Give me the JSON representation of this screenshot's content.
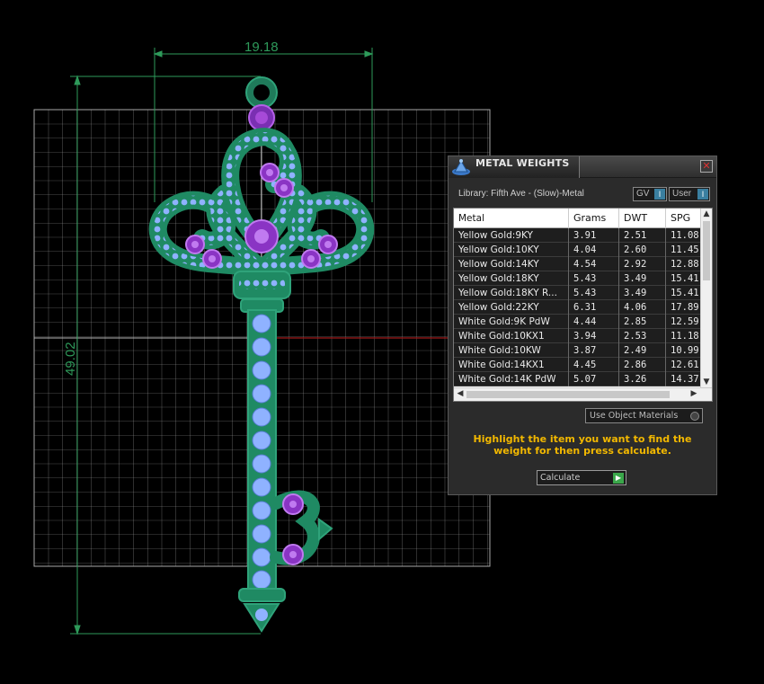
{
  "viewport": {
    "width_dimension": "19.18",
    "height_dimension": "49.02"
  },
  "panel": {
    "title": "METAL WEIGHTS",
    "close_glyph": "✕",
    "library_label": "Library: Fifth Ave - (Slow)-Metal",
    "gv_label": "GV",
    "user_label": "User",
    "toggle_glyph": "I",
    "columns": [
      "Metal",
      "Grams",
      "DWT",
      "SPG"
    ],
    "rows": [
      {
        "metal": "Yellow Gold:9KY",
        "grams": "3.91",
        "dwt": "2.51",
        "spg": "11.08"
      },
      {
        "metal": "Yellow Gold:10KY",
        "grams": "4.04",
        "dwt": "2.60",
        "spg": "11.45"
      },
      {
        "metal": "Yellow Gold:14KY",
        "grams": "4.54",
        "dwt": "2.92",
        "spg": "12.88"
      },
      {
        "metal": "Yellow Gold:18KY",
        "grams": "5.43",
        "dwt": "3.49",
        "spg": "15.41"
      },
      {
        "metal": "Yellow Gold:18KY R...",
        "grams": "5.43",
        "dwt": "3.49",
        "spg": "15.41"
      },
      {
        "metal": "Yellow Gold:22KY",
        "grams": "6.31",
        "dwt": "4.06",
        "spg": "17.89"
      },
      {
        "metal": "White Gold:9K PdW",
        "grams": "4.44",
        "dwt": "2.85",
        "spg": "12.59"
      },
      {
        "metal": "White Gold:10KX1",
        "grams": "3.94",
        "dwt": "2.53",
        "spg": "11.18"
      },
      {
        "metal": "White Gold:10KW",
        "grams": "3.87",
        "dwt": "2.49",
        "spg": "10.99"
      },
      {
        "metal": "White Gold:14KX1",
        "grams": "4.45",
        "dwt": "2.86",
        "spg": "12.61"
      },
      {
        "metal": "White Gold:14K PdW",
        "grams": "5.07",
        "dwt": "3.26",
        "spg": "14.37"
      }
    ],
    "use_object_materials_label": "Use Object Materials",
    "hint_text": "Highlight the item you want to find the weight for then press calculate.",
    "calculate_label": "Calculate",
    "accent_color": "#f2b800"
  }
}
